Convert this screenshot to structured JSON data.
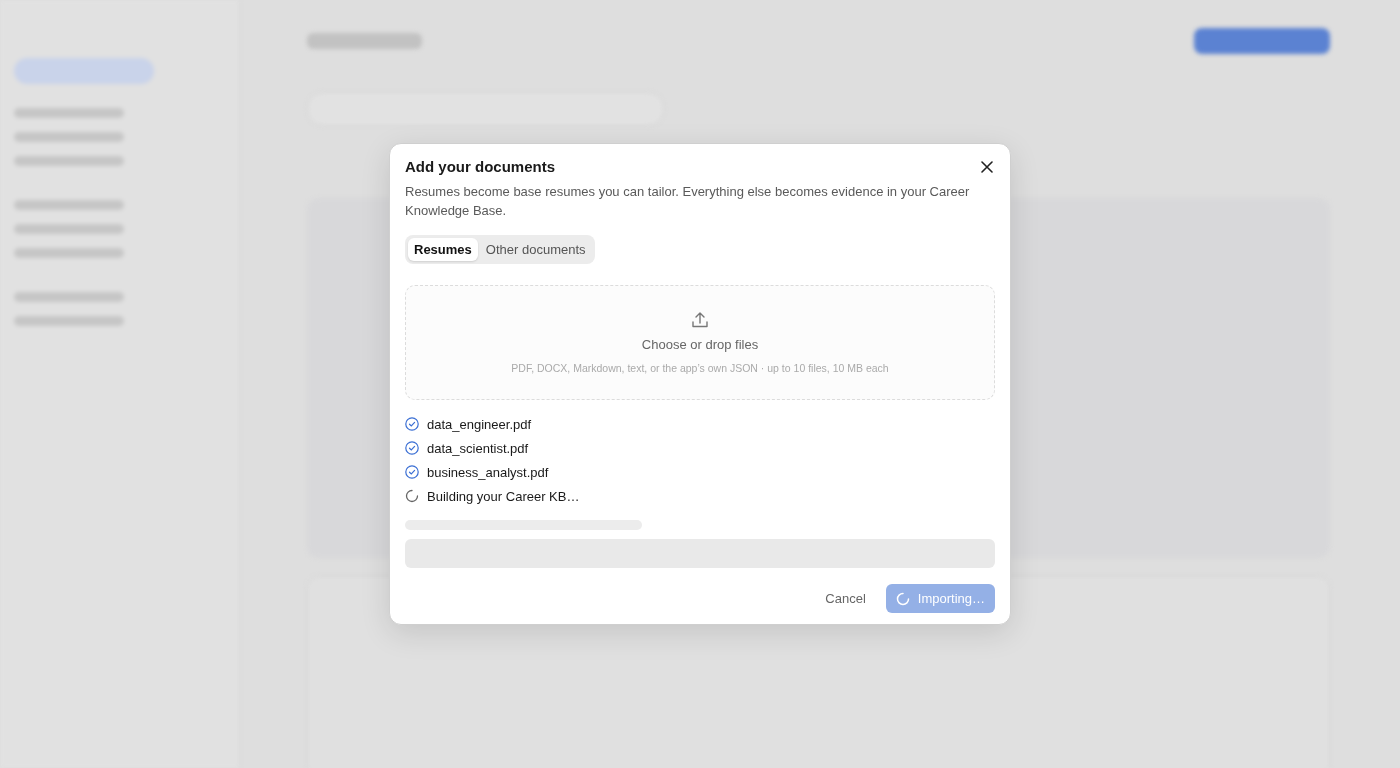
{
  "dialog": {
    "title": "Add your documents",
    "description": "Resumes become base resumes you can tailor. Everything else becomes evidence in your Career Knowledge Base.",
    "tabs": [
      {
        "label": "Resumes",
        "selected": true
      },
      {
        "label": "Other documents",
        "selected": false
      }
    ],
    "dropzone": {
      "title": "Choose or drop files",
      "hint": "PDF, DOCX, Markdown, text, or the app’s own JSON · up to 10 files, 10 MB each"
    },
    "files": [
      {
        "name": "data_engineer.pdf",
        "done": true
      },
      {
        "name": "data_scientist.pdf",
        "done": true
      },
      {
        "name": "business_analyst.pdf",
        "done": true
      },
      {
        "name": "Building your Career KB…",
        "done": false
      }
    ],
    "cancel": "Cancel",
    "submit": {
      "label": "Importing…",
      "busy": true
    }
  }
}
